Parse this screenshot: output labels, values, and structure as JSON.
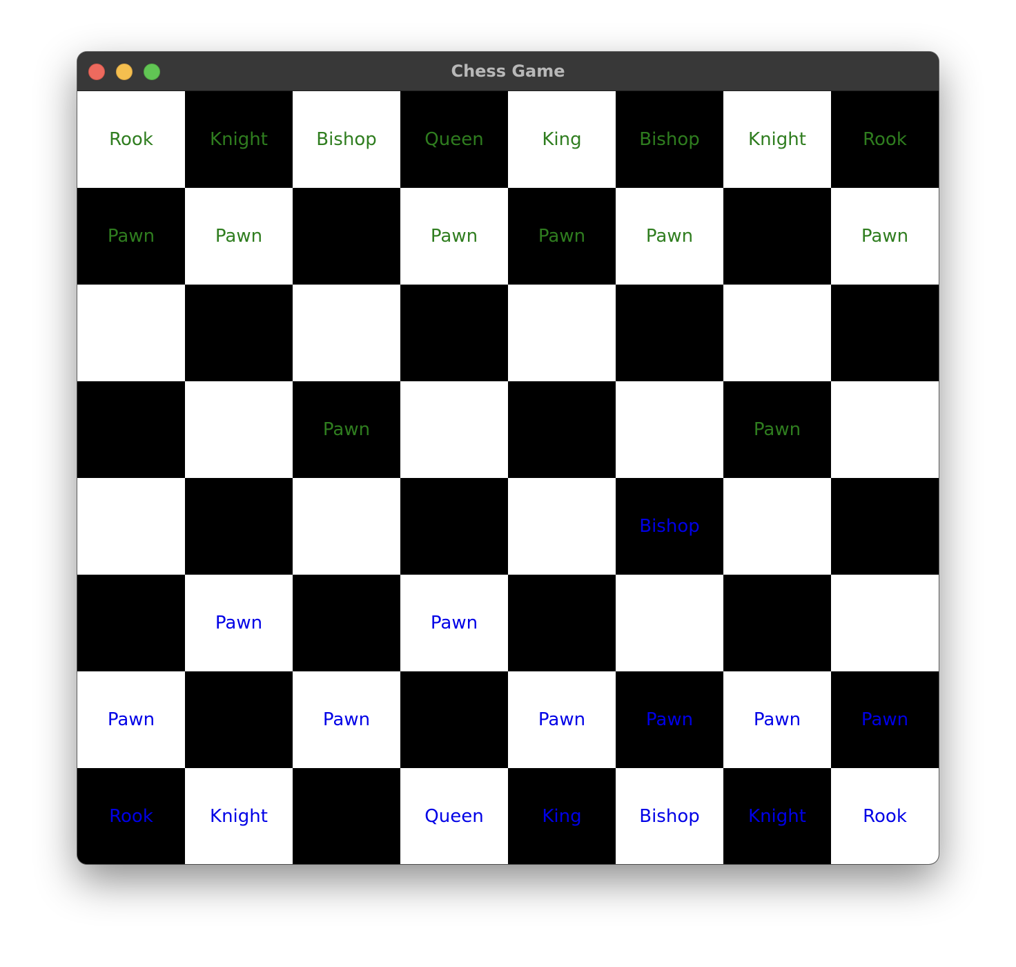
{
  "window": {
    "title": "Chess Game"
  },
  "colors": {
    "light_square": "#ffffff",
    "dark_square": "#000000",
    "green_pieces": "#2f7d1f",
    "blue_pieces": "#0000e6"
  },
  "board": {
    "rows": [
      [
        {
          "piece": "Rook",
          "side": "green"
        },
        {
          "piece": "Knight",
          "side": "green"
        },
        {
          "piece": "Bishop",
          "side": "green"
        },
        {
          "piece": "Queen",
          "side": "green"
        },
        {
          "piece": "King",
          "side": "green"
        },
        {
          "piece": "Bishop",
          "side": "green"
        },
        {
          "piece": "Knight",
          "side": "green"
        },
        {
          "piece": "Rook",
          "side": "green"
        }
      ],
      [
        {
          "piece": "Pawn",
          "side": "green"
        },
        {
          "piece": "Pawn",
          "side": "green"
        },
        {
          "piece": "",
          "side": ""
        },
        {
          "piece": "Pawn",
          "side": "green"
        },
        {
          "piece": "Pawn",
          "side": "green"
        },
        {
          "piece": "Pawn",
          "side": "green"
        },
        {
          "piece": "",
          "side": ""
        },
        {
          "piece": "Pawn",
          "side": "green"
        }
      ],
      [
        {
          "piece": "",
          "side": ""
        },
        {
          "piece": "",
          "side": ""
        },
        {
          "piece": "",
          "side": ""
        },
        {
          "piece": "",
          "side": ""
        },
        {
          "piece": "",
          "side": ""
        },
        {
          "piece": "",
          "side": ""
        },
        {
          "piece": "",
          "side": ""
        },
        {
          "piece": "",
          "side": ""
        }
      ],
      [
        {
          "piece": "",
          "side": ""
        },
        {
          "piece": "",
          "side": ""
        },
        {
          "piece": "Pawn",
          "side": "green"
        },
        {
          "piece": "",
          "side": ""
        },
        {
          "piece": "",
          "side": ""
        },
        {
          "piece": "",
          "side": ""
        },
        {
          "piece": "Pawn",
          "side": "green"
        },
        {
          "piece": "",
          "side": ""
        }
      ],
      [
        {
          "piece": "",
          "side": ""
        },
        {
          "piece": "",
          "side": ""
        },
        {
          "piece": "",
          "side": ""
        },
        {
          "piece": "",
          "side": ""
        },
        {
          "piece": "",
          "side": ""
        },
        {
          "piece": "Bishop",
          "side": "blue"
        },
        {
          "piece": "",
          "side": ""
        },
        {
          "piece": "",
          "side": ""
        }
      ],
      [
        {
          "piece": "",
          "side": ""
        },
        {
          "piece": "Pawn",
          "side": "blue"
        },
        {
          "piece": "",
          "side": ""
        },
        {
          "piece": "Pawn",
          "side": "blue"
        },
        {
          "piece": "",
          "side": ""
        },
        {
          "piece": "",
          "side": ""
        },
        {
          "piece": "",
          "side": ""
        },
        {
          "piece": "",
          "side": ""
        }
      ],
      [
        {
          "piece": "Pawn",
          "side": "blue"
        },
        {
          "piece": "",
          "side": ""
        },
        {
          "piece": "Pawn",
          "side": "blue"
        },
        {
          "piece": "",
          "side": ""
        },
        {
          "piece": "Pawn",
          "side": "blue"
        },
        {
          "piece": "Pawn",
          "side": "blue"
        },
        {
          "piece": "Pawn",
          "side": "blue"
        },
        {
          "piece": "Pawn",
          "side": "blue"
        }
      ],
      [
        {
          "piece": "Rook",
          "side": "blue"
        },
        {
          "piece": "Knight",
          "side": "blue"
        },
        {
          "piece": "",
          "side": ""
        },
        {
          "piece": "Queen",
          "side": "blue"
        },
        {
          "piece": "King",
          "side": "blue"
        },
        {
          "piece": "Bishop",
          "side": "blue"
        },
        {
          "piece": "Knight",
          "side": "blue"
        },
        {
          "piece": "Rook",
          "side": "blue"
        }
      ]
    ]
  }
}
